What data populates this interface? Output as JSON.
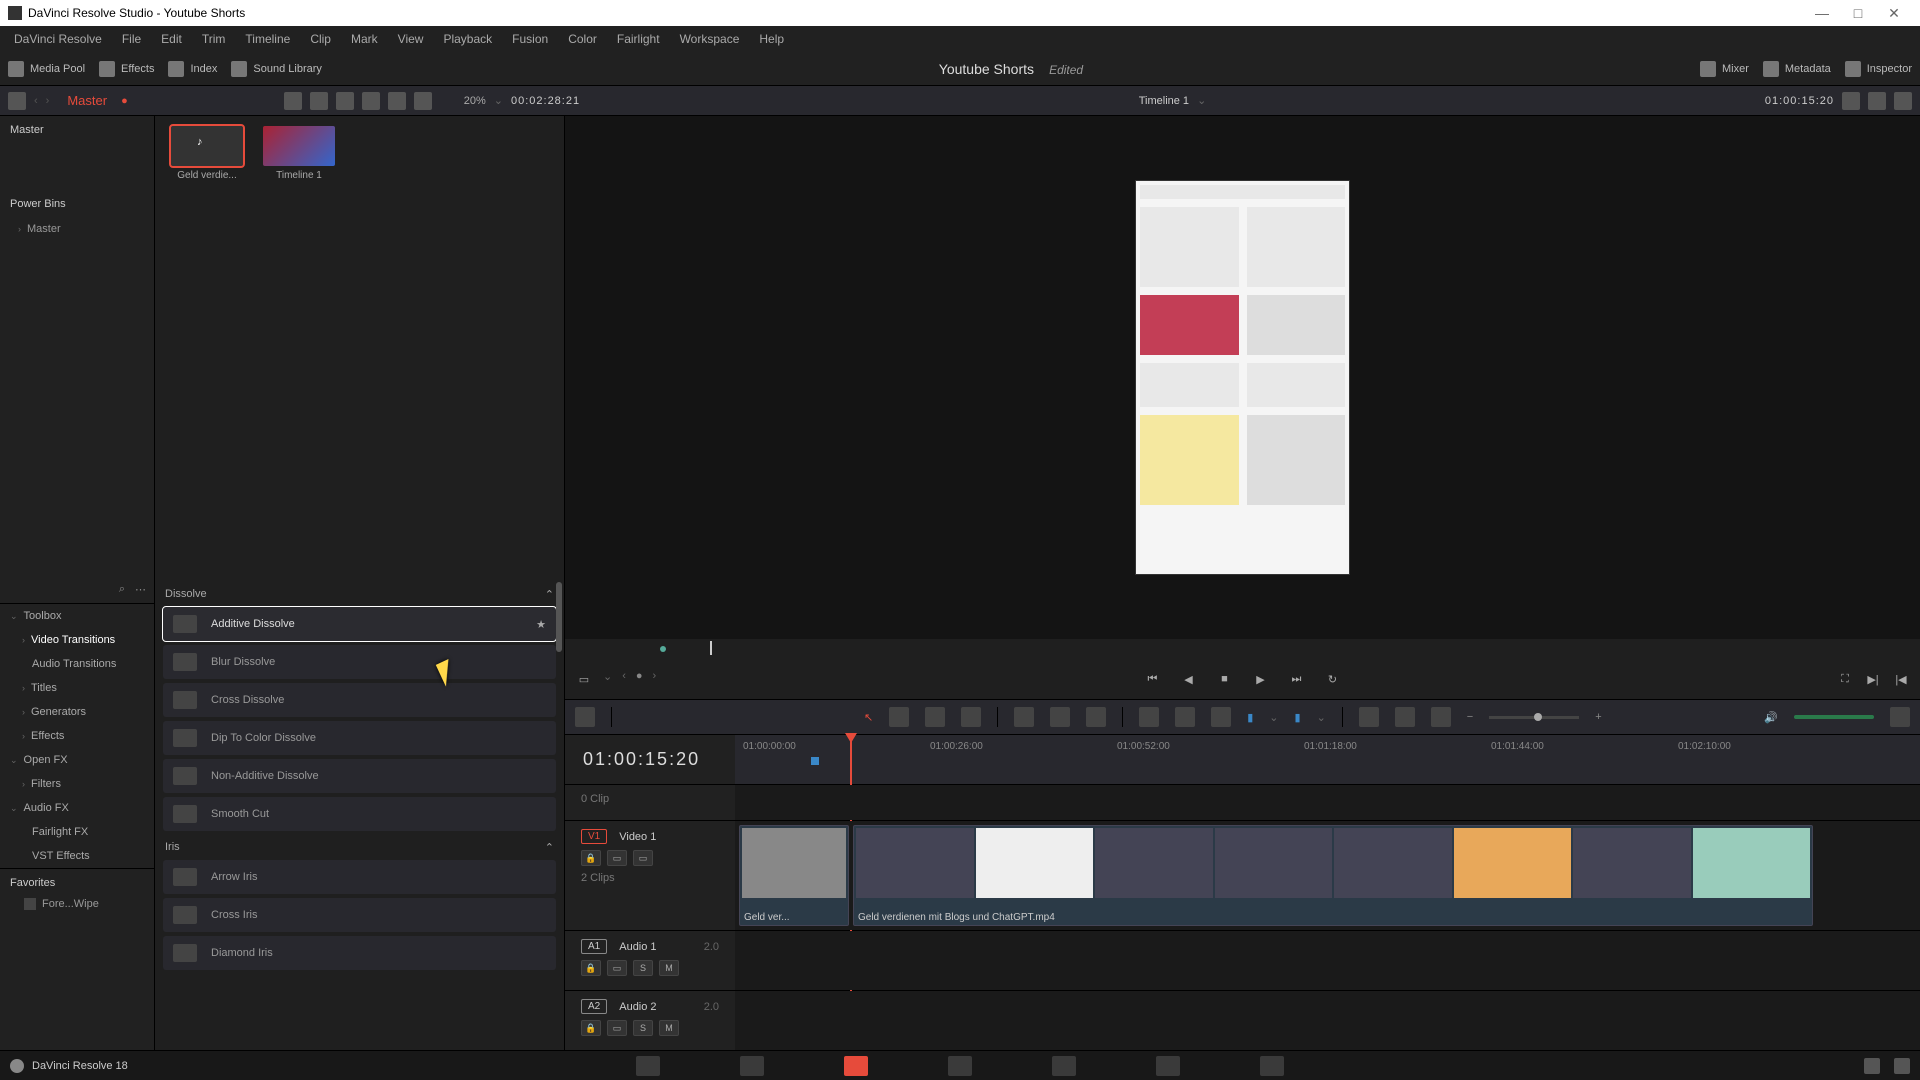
{
  "titlebar": {
    "text": "DaVinci Resolve Studio - Youtube Shorts"
  },
  "menu": [
    "DaVinci Resolve",
    "File",
    "Edit",
    "Trim",
    "Timeline",
    "Clip",
    "Mark",
    "View",
    "Playback",
    "Fusion",
    "Color",
    "Fairlight",
    "Workspace",
    "Help"
  ],
  "sup": {
    "mediapool": "Media Pool",
    "effects": "Effects",
    "index": "Index",
    "soundlib": "Sound Library",
    "title": "Youtube Shorts",
    "edited": "Edited",
    "mixer": "Mixer",
    "metadata": "Metadata",
    "inspector": "Inspector"
  },
  "toolrow": {
    "master": "Master",
    "zoom": "20%",
    "tc": "00:02:28:21",
    "tlname": "Timeline 1",
    "righttc": "01:00:15:20"
  },
  "leftnav": {
    "master": "Master",
    "powerbins": "Power Bins",
    "pbmaster": "Master"
  },
  "clips": [
    {
      "label": "Geld verdie..."
    },
    {
      "label": "Timeline 1"
    }
  ],
  "fxtree": {
    "toolbox": "Toolbox",
    "videotrans": "Video Transitions",
    "audiotrans": "Audio Transitions",
    "titles": "Titles",
    "generators": "Generators",
    "effects": "Effects",
    "openfx": "Open FX",
    "filters": "Filters",
    "audiofx": "Audio FX",
    "fairlightfx": "Fairlight FX",
    "vsteffects": "VST Effects"
  },
  "fxlist": {
    "cat1": "Dissolve",
    "items": [
      "Additive Dissolve",
      "Blur Dissolve",
      "Cross Dissolve",
      "Dip To Color Dissolve",
      "Non-Additive Dissolve",
      "Smooth Cut"
    ],
    "cat2": "Iris",
    "items2": [
      "Arrow Iris",
      "Cross Iris",
      "Diamond Iris"
    ]
  },
  "favorites": {
    "title": "Favorites",
    "item": "Fore...Wipe"
  },
  "tl": {
    "tc": "01:00:15:20",
    "ruler": [
      "01:00:00:00",
      "01:00:26:00",
      "01:00:52:00",
      "01:01:18:00",
      "01:01:44:00",
      "01:02:10:00"
    ],
    "track0": "0 Clip",
    "v1tag": "V1",
    "v1": "Video 1",
    "v1clips": "2 Clips",
    "clip1name": "Geld ver...",
    "clip2name": "Geld verdienen mit Blogs und ChatGPT.mp4",
    "a1tag": "A1",
    "a1": "Audio 1",
    "a1ch": "2.0",
    "a2tag": "A2",
    "a2": "Audio 2",
    "a2ch": "2.0",
    "s": "S",
    "m": "M"
  },
  "status": "DaVinci Resolve 18"
}
